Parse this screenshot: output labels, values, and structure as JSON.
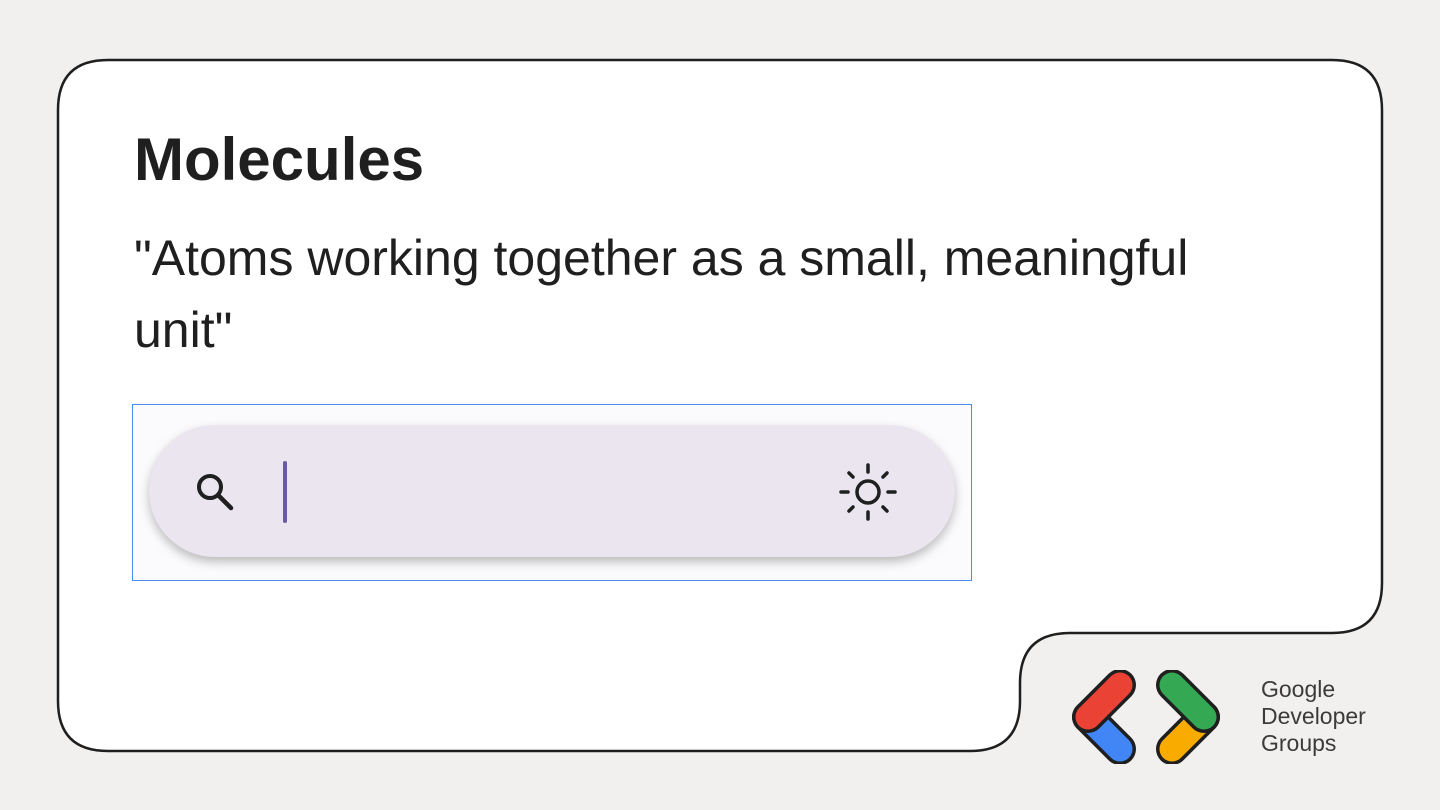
{
  "slide": {
    "title": "Molecules",
    "quote": "\"Atoms working together as a small, meaningful unit\""
  },
  "search_demo": {
    "input_value": "",
    "leading_icon": "search-icon",
    "trailing_icon": "brightness-icon"
  },
  "branding": {
    "line1": "Google",
    "line2": "Developer",
    "line3": "Groups"
  },
  "colors": {
    "background": "#f1f0ee",
    "card": "#ffffff",
    "search_bar": "#ebe5ef",
    "caret": "#6a5aa3",
    "frame_highlight": "#4a8fe7",
    "logo_red": "#ea4335",
    "logo_blue": "#4285f4",
    "logo_green": "#34a853",
    "logo_yellow": "#f9ab00"
  }
}
